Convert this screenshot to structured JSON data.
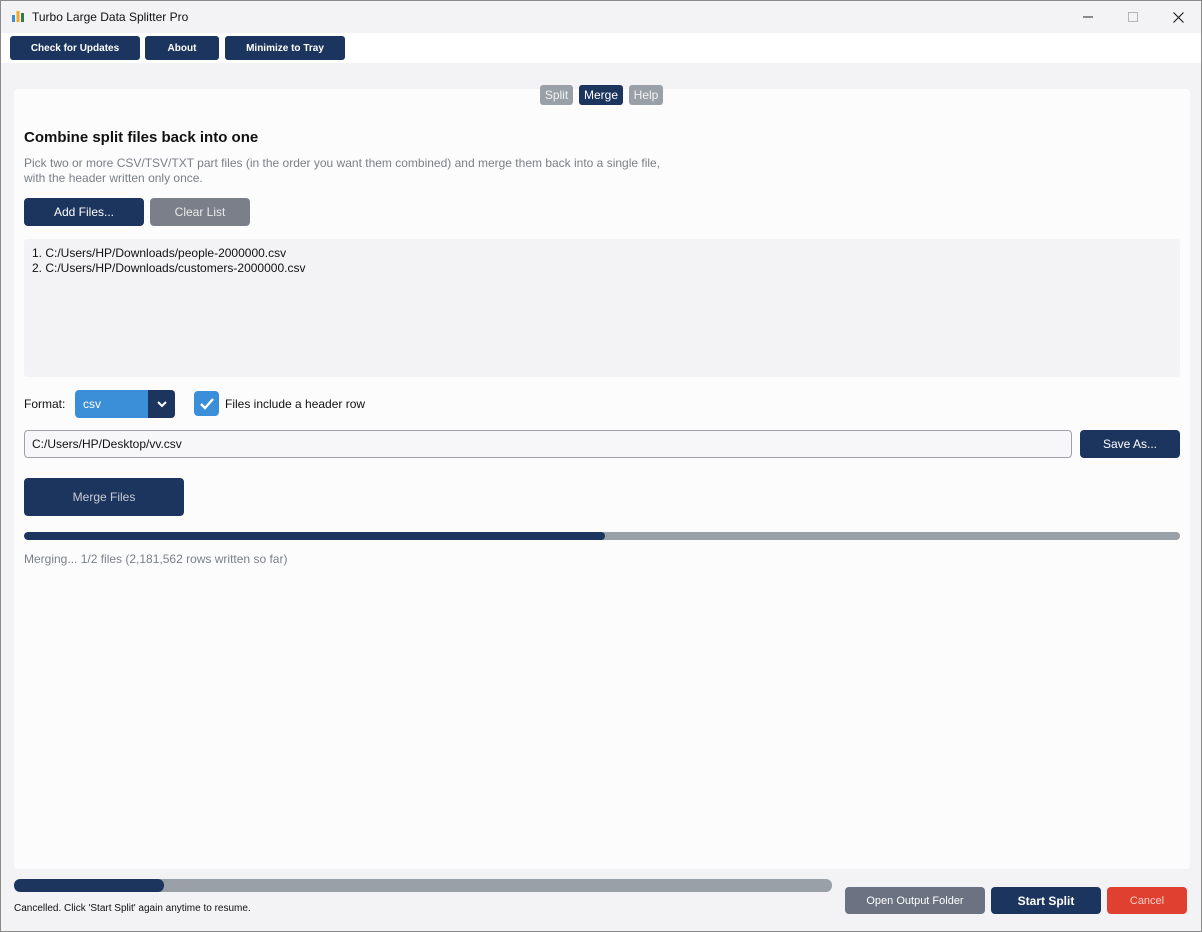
{
  "window": {
    "title": "Turbo Large Data Splitter Pro"
  },
  "toolbar": {
    "check_updates": "Check for Updates",
    "about": "About",
    "minimize_tray": "Minimize to Tray"
  },
  "tabs": [
    {
      "label": "Split",
      "active": false
    },
    {
      "label": "Merge",
      "active": true
    },
    {
      "label": "Help",
      "active": false
    }
  ],
  "merge": {
    "heading": "Combine split files back into one",
    "description": "Pick two or more CSV/TSV/TXT part files (in the order you want them combined) and merge them back into a single file, with the header written only once.",
    "add_files": "Add Files...",
    "clear_list": "Clear List",
    "files": [
      "1. C:/Users/HP/Downloads/people-2000000.csv",
      "2. C:/Users/HP/Downloads/customers-2000000.csv"
    ],
    "format_label": "Format:",
    "format_value": "csv",
    "header_checkbox_label": "Files include a header row",
    "header_checked": true,
    "output_path": "C:/Users/HP/Desktop/vv.csv",
    "save_as": "Save As...",
    "merge_button": "Merge Files",
    "progress": 0.503,
    "status": "Merging... 1/2 files (2,181,562 rows written so far)"
  },
  "footer": {
    "progress": 0.183,
    "status": "Cancelled. Click 'Start Split' again anytime to resume.",
    "open_folder": "Open Output Folder",
    "start_split": "Start Split",
    "cancel": "Cancel"
  },
  "colors": {
    "navy": "#1c355e",
    "accent_blue": "#3b8ed8",
    "grey": "#7b7f89",
    "cancel_red": "#e0402f"
  },
  "icons": {
    "app": "app-logo-icon",
    "minimize": "minimize-icon",
    "maximize": "maximize-icon",
    "close": "close-icon",
    "dropdown": "chevron-down-icon",
    "check": "checkmark-icon"
  }
}
